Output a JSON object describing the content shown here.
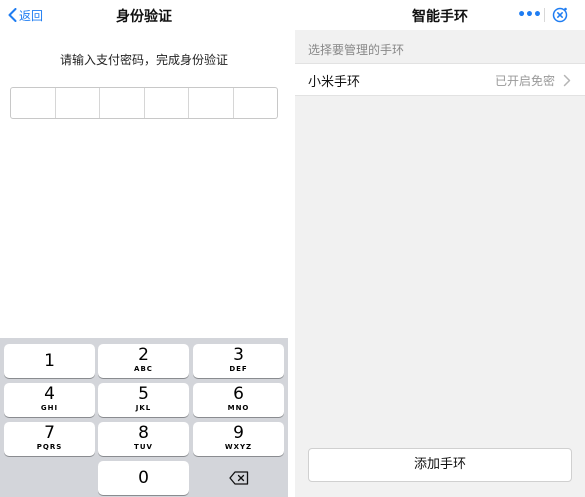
{
  "left": {
    "back_label": "返回",
    "title": "身份验证",
    "prompt": "请输入支付密码，完成身份验证",
    "password_cells": 6,
    "keypad": {
      "keys": [
        {
          "num": "1",
          "letters": ""
        },
        {
          "num": "2",
          "letters": "ABC"
        },
        {
          "num": "3",
          "letters": "DEF"
        },
        {
          "num": "4",
          "letters": "GHI"
        },
        {
          "num": "5",
          "letters": "JKL"
        },
        {
          "num": "6",
          "letters": "MNO"
        },
        {
          "num": "7",
          "letters": "PQRS"
        },
        {
          "num": "8",
          "letters": "TUV"
        },
        {
          "num": "9",
          "letters": "WXYZ"
        },
        {
          "num": "0",
          "letters": ""
        }
      ],
      "delete_icon": "backspace-icon"
    }
  },
  "right": {
    "title": "智能手环",
    "more_icon": "more-icon",
    "close_icon": "close-icon",
    "section_label": "选择要管理的手环",
    "items": [
      {
        "name": "小米手环",
        "status": "已开启免密"
      }
    ],
    "add_button": "添加手环"
  },
  "colors": {
    "accent": "#1f7df2",
    "keypad_bg": "#d3d5da",
    "page_bg_right": "#f1f1f1",
    "muted_text": "#999999"
  }
}
